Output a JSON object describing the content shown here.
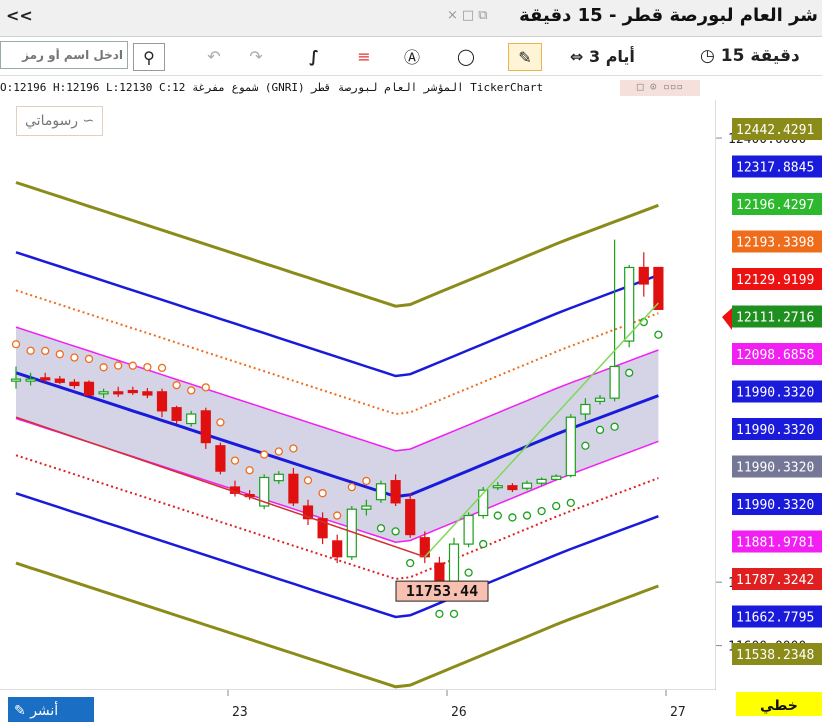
{
  "window": {
    "collapse_label": "<<",
    "title": "شر العام لبورصة قطر - 15 دقيقة"
  },
  "toolbar": {
    "symbol_placeholder": "ادخل اسم أو رمز",
    "period_label": "3 أيام",
    "interval_label": "15 دقيقة"
  },
  "info": {
    "text": "TickerChart المؤشر العام لبورصة قطر (GNRI) شموع مفرغة O:12196  H:12196  L:12130  C:12"
  },
  "drawings": {
    "label": "رسوماتي"
  },
  "bottom": {
    "left_button": "أنشر",
    "right_button": "خطي"
  },
  "axis": {
    "price_ticks": [
      "12400.0000",
      "11700.0000",
      "11600.0000"
    ],
    "date_ticks": [
      "23",
      "26",
      "27"
    ]
  },
  "price_labels": [
    {
      "text": "12442.4291",
      "color": "#8b8b1a"
    },
    {
      "text": "12317.8845",
      "color": "#1a1adb"
    },
    {
      "text": "12196.4297",
      "color": "#2eb82e"
    },
    {
      "text": "12193.3398",
      "color": "#ef6c1a"
    },
    {
      "text": "12129.9199",
      "color": "#e11"
    },
    {
      "text": "12111.2716",
      "color": "#1f8f1f"
    },
    {
      "text": "12098.6858",
      "color": "#f21ff2"
    },
    {
      "text": "11990.3320",
      "color": "#1a1adb"
    },
    {
      "text": "11990.3320",
      "color": "#1a1adb"
    },
    {
      "text": "11990.3320",
      "color": "#747795"
    },
    {
      "text": "11990.3320",
      "color": "#1a1adb"
    },
    {
      "text": "11881.9781",
      "color": "#f21ff2"
    },
    {
      "text": "11787.3242",
      "color": "#e02020"
    },
    {
      "text": "11662.7795",
      "color": "#1a1adb"
    },
    {
      "text": "11538.2348",
      "color": "#8b8b1a"
    }
  ],
  "annotation": {
    "low_label": "11753.44"
  },
  "colors": {
    "bull": "#1aa01a",
    "bear": "#e01010",
    "band": "#c9c9e0"
  },
  "chart_data": {
    "type": "candlestick",
    "ylim": [
      11530,
      12460
    ],
    "candles": [
      {
        "o": 12020,
        "h": 12040,
        "l": 12005,
        "c": 12020
      },
      {
        "o": 12020,
        "h": 12030,
        "l": 12010,
        "c": 12020
      },
      {
        "o": 12022,
        "h": 12030,
        "l": 12015,
        "c": 12020
      },
      {
        "o": 12020,
        "h": 12025,
        "l": 12012,
        "c": 12015
      },
      {
        "o": 12015,
        "h": 12020,
        "l": 12005,
        "c": 12010
      },
      {
        "o": 12015,
        "h": 12018,
        "l": 11995,
        "c": 11995
      },
      {
        "o": 11998,
        "h": 12005,
        "l": 11990,
        "c": 12000
      },
      {
        "o": 12000,
        "h": 12008,
        "l": 11992,
        "c": 11998
      },
      {
        "o": 12002,
        "h": 12008,
        "l": 11995,
        "c": 12000
      },
      {
        "o": 12000,
        "h": 12006,
        "l": 11990,
        "c": 11995
      },
      {
        "o": 12000,
        "h": 12005,
        "l": 11960,
        "c": 11970
      },
      {
        "o": 11975,
        "h": 11978,
        "l": 11950,
        "c": 11955
      },
      {
        "o": 11950,
        "h": 11970,
        "l": 11945,
        "c": 11965
      },
      {
        "o": 11970,
        "h": 11975,
        "l": 11910,
        "c": 11920
      },
      {
        "o": 11915,
        "h": 11920,
        "l": 11870,
        "c": 11875
      },
      {
        "o": 11850,
        "h": 11860,
        "l": 11835,
        "c": 11840
      },
      {
        "o": 11838,
        "h": 11845,
        "l": 11830,
        "c": 11835
      },
      {
        "o": 11820,
        "h": 11870,
        "l": 11815,
        "c": 11865
      },
      {
        "o": 11860,
        "h": 11875,
        "l": 11855,
        "c": 11870
      },
      {
        "o": 11870,
        "h": 11880,
        "l": 11820,
        "c": 11825
      },
      {
        "o": 11820,
        "h": 11830,
        "l": 11790,
        "c": 11800
      },
      {
        "o": 11800,
        "h": 11810,
        "l": 11760,
        "c": 11770
      },
      {
        "o": 11765,
        "h": 11775,
        "l": 11730,
        "c": 11740
      },
      {
        "o": 11740,
        "h": 11820,
        "l": 11735,
        "c": 11815
      },
      {
        "o": 11815,
        "h": 11830,
        "l": 11805,
        "c": 11820
      },
      {
        "o": 11830,
        "h": 11860,
        "l": 11825,
        "c": 11855
      },
      {
        "o": 11860,
        "h": 11870,
        "l": 11820,
        "c": 11825
      },
      {
        "o": 11830,
        "h": 11840,
        "l": 11770,
        "c": 11775
      },
      {
        "o": 11770,
        "h": 11780,
        "l": 11730,
        "c": 11740
      },
      {
        "o": 11730,
        "h": 11740,
        "l": 11690,
        "c": 11700
      },
      {
        "o": 11700,
        "h": 11770,
        "l": 11690,
        "c": 11760
      },
      {
        "o": 11760,
        "h": 11810,
        "l": 11755,
        "c": 11805
      },
      {
        "o": 11805,
        "h": 11850,
        "l": 11800,
        "c": 11845
      },
      {
        "o": 11850,
        "h": 11858,
        "l": 11845,
        "c": 11852
      },
      {
        "o": 11852,
        "h": 11856,
        "l": 11842,
        "c": 11846
      },
      {
        "o": 11848,
        "h": 11860,
        "l": 11845,
        "c": 11856
      },
      {
        "o": 11856,
        "h": 11865,
        "l": 11852,
        "c": 11862
      },
      {
        "o": 11862,
        "h": 11870,
        "l": 11860,
        "c": 11867
      },
      {
        "o": 11868,
        "h": 11965,
        "l": 11865,
        "c": 11960
      },
      {
        "o": 11965,
        "h": 11990,
        "l": 11955,
        "c": 11980
      },
      {
        "o": 11985,
        "h": 11995,
        "l": 11980,
        "c": 11990
      },
      {
        "o": 11990,
        "h": 12240,
        "l": 11985,
        "c": 12040
      },
      {
        "o": 12080,
        "h": 12200,
        "l": 12070,
        "c": 12196
      },
      {
        "o": 12196,
        "h": 12220,
        "l": 12150,
        "c": 12170
      },
      {
        "o": 12196,
        "h": 12196,
        "l": 12130,
        "c": 12130
      }
    ]
  }
}
